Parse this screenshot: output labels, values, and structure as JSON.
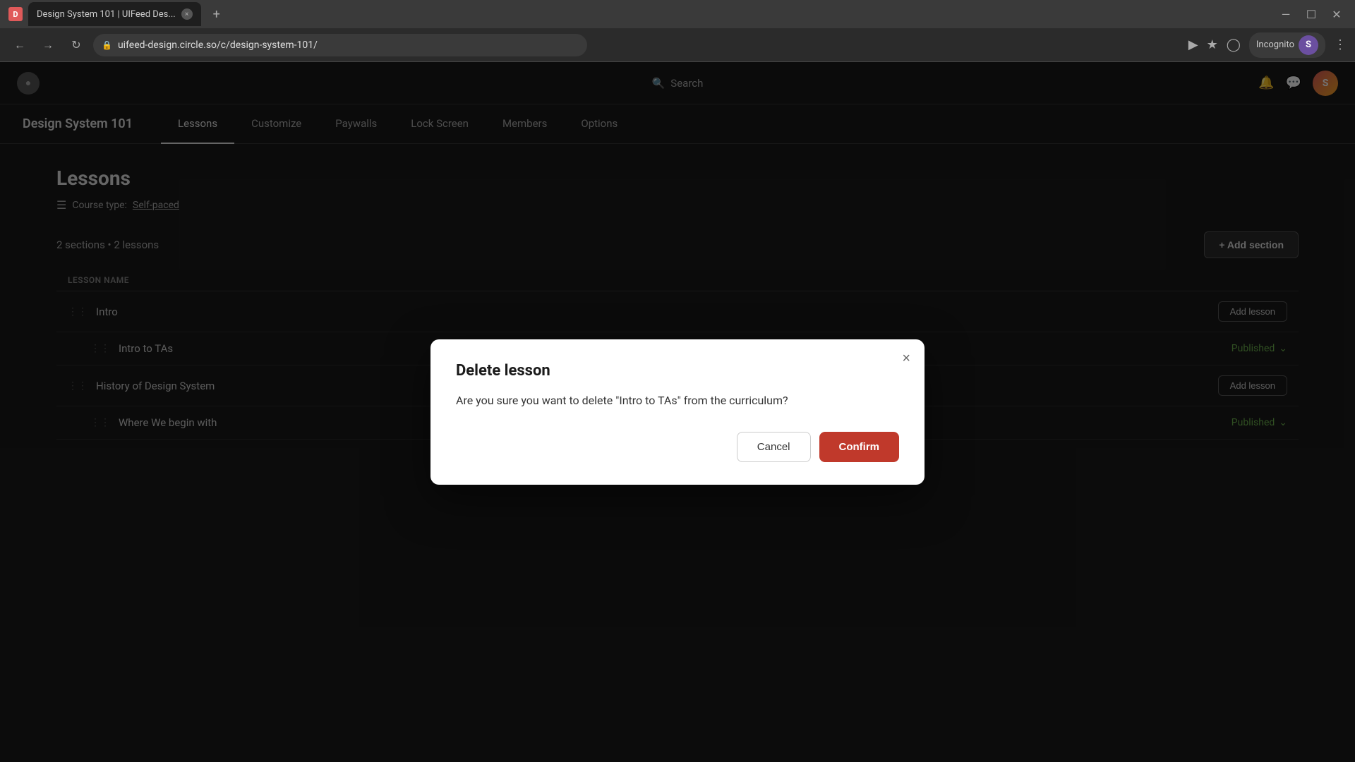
{
  "browser": {
    "tab_title": "Design System 101 | UIFeed Des...",
    "tab_close": "×",
    "new_tab": "+",
    "url": "uifeed-design.circle.so/c/design-system-101/",
    "lock_icon": "🔒",
    "window_minimize": "—",
    "window_maximize": "⬜",
    "window_close": "×",
    "incognito_label": "Incognito",
    "menu_dots": "⋮"
  },
  "topbar": {
    "search_placeholder": "Search",
    "user_initials": "S"
  },
  "course_nav": {
    "title": "Design System 101",
    "tabs": [
      {
        "label": "Lessons",
        "active": true
      },
      {
        "label": "Customize",
        "active": false
      },
      {
        "label": "Paywalls",
        "active": false
      },
      {
        "label": "Lock Screen",
        "active": false
      },
      {
        "label": "Members",
        "active": false
      },
      {
        "label": "Options",
        "active": false
      }
    ]
  },
  "lessons_page": {
    "heading": "Lessons",
    "course_type_label": "Course type:",
    "course_type_value": "Self-paced",
    "sections_count": "2 sections • 2 lessons",
    "add_section_label": "+ Add section",
    "column_header": "LESSON NAME",
    "lessons": [
      {
        "name": "Intro",
        "drag": "⠿",
        "type": "section"
      },
      {
        "name": "Intro to TAs",
        "drag": "⠿",
        "status": "Published",
        "type": "lesson"
      },
      {
        "name": "History of Design System",
        "drag": "⠿",
        "type": "section"
      },
      {
        "name": "Where We begin with",
        "drag": "⠿",
        "status": "Published",
        "type": "lesson"
      }
    ],
    "add_lesson_label": "Add lesson"
  },
  "modal": {
    "title": "Delete lesson",
    "body": "Are you sure you want to delete \"Intro to TAs\" from the curriculum?",
    "cancel_label": "Cancel",
    "confirm_label": "Confirm",
    "close_icon": "×"
  },
  "colors": {
    "confirm_bg": "#c0392b",
    "published": "#6ab04c"
  }
}
